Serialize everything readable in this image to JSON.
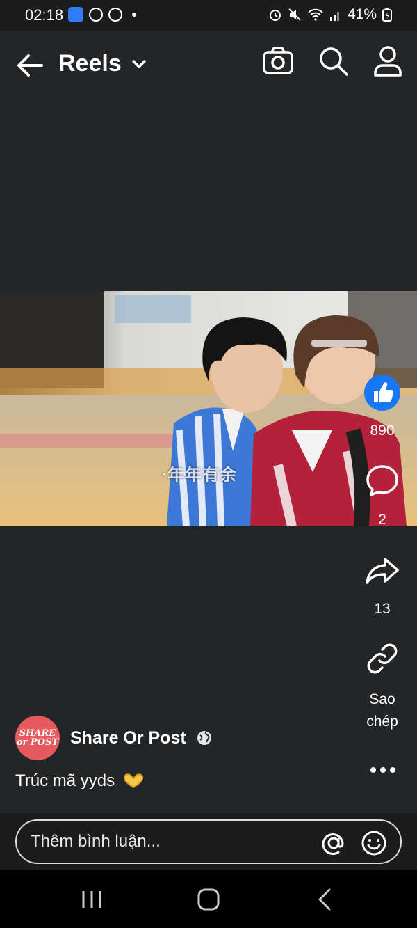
{
  "status_bar": {
    "time": "02:18",
    "battery": "41%",
    "left_icons": [
      "webtoon-app-icon",
      "messenger-icon",
      "messenger-icon",
      "notification-dot-icon"
    ],
    "right_icons": [
      "alarm-icon",
      "mute-icon",
      "wifi-icon",
      "signal-icon",
      "battery-charging-icon"
    ]
  },
  "header": {
    "title": "Reels",
    "back_icon": "arrow-left-icon",
    "dropdown_icon": "chevron-down-icon",
    "actions": [
      "camera-icon",
      "search-icon",
      "profile-icon"
    ]
  },
  "video": {
    "overlay_text": "·年年有余"
  },
  "actions": {
    "like_count": "890",
    "comment_count": "2",
    "share_count": "13",
    "copy_link_label": "Sao chép"
  },
  "post": {
    "author": "Share Or Post",
    "avatar_text_top": "SHARE",
    "avatar_text_bottom": "or POST",
    "caption": "Trúc mã yyds",
    "caption_emoji": "heart-hands-icon",
    "privacy_icon": "globe-icon"
  },
  "comment": {
    "placeholder": "Thêm bình luận..."
  },
  "colors": {
    "background": "#242526",
    "like_blue": "#1877f2",
    "avatar_red": "#e65a5f"
  }
}
